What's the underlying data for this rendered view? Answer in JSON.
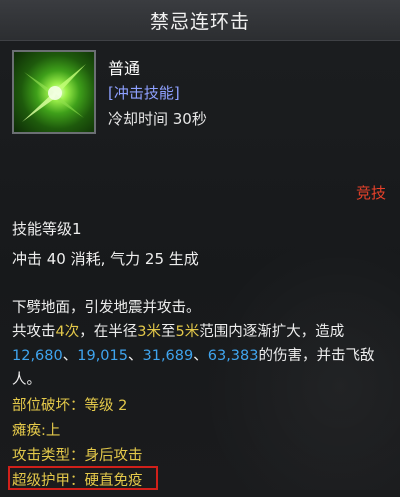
{
  "header": {
    "title": "禁忌连环击"
  },
  "skill": {
    "icon": "green-slash-icon",
    "rarity": "普通",
    "type": "[冲击技能]",
    "cooldown": "冷却时间 30秒",
    "tag": "竞技",
    "level": "技能等级1",
    "cost": "冲击 40 消耗, 气力 25 生成"
  },
  "description": {
    "line1": "下劈地面，引发地震并攻击。",
    "line2_a": "共攻击",
    "line2_times": "4次",
    "line2_b": "，在半径",
    "line2_r1": "3米",
    "line2_c": "至",
    "line2_r2": "5米",
    "line2_d": "范围内逐渐扩大，造成",
    "damage": [
      "12,680",
      "19,015",
      "31,689",
      "63,383"
    ],
    "sep": "、",
    "line3_tail": "的伤害，并击飞敌",
    "line4": "人。"
  },
  "attributes": {
    "part_break": "部位破坏：等级 2",
    "paralysis": "瘫痪:上",
    "attack_type": "攻击类型：身后攻击",
    "super_armor": "超级护甲：硬直免疫"
  },
  "colors": {
    "highlight_yellow": "#e3c84a",
    "damage_blue": "#3fa4ee",
    "tag_red": "#e8412a",
    "type_blue": "#8ea0ff",
    "box_red": "#d0201a"
  }
}
